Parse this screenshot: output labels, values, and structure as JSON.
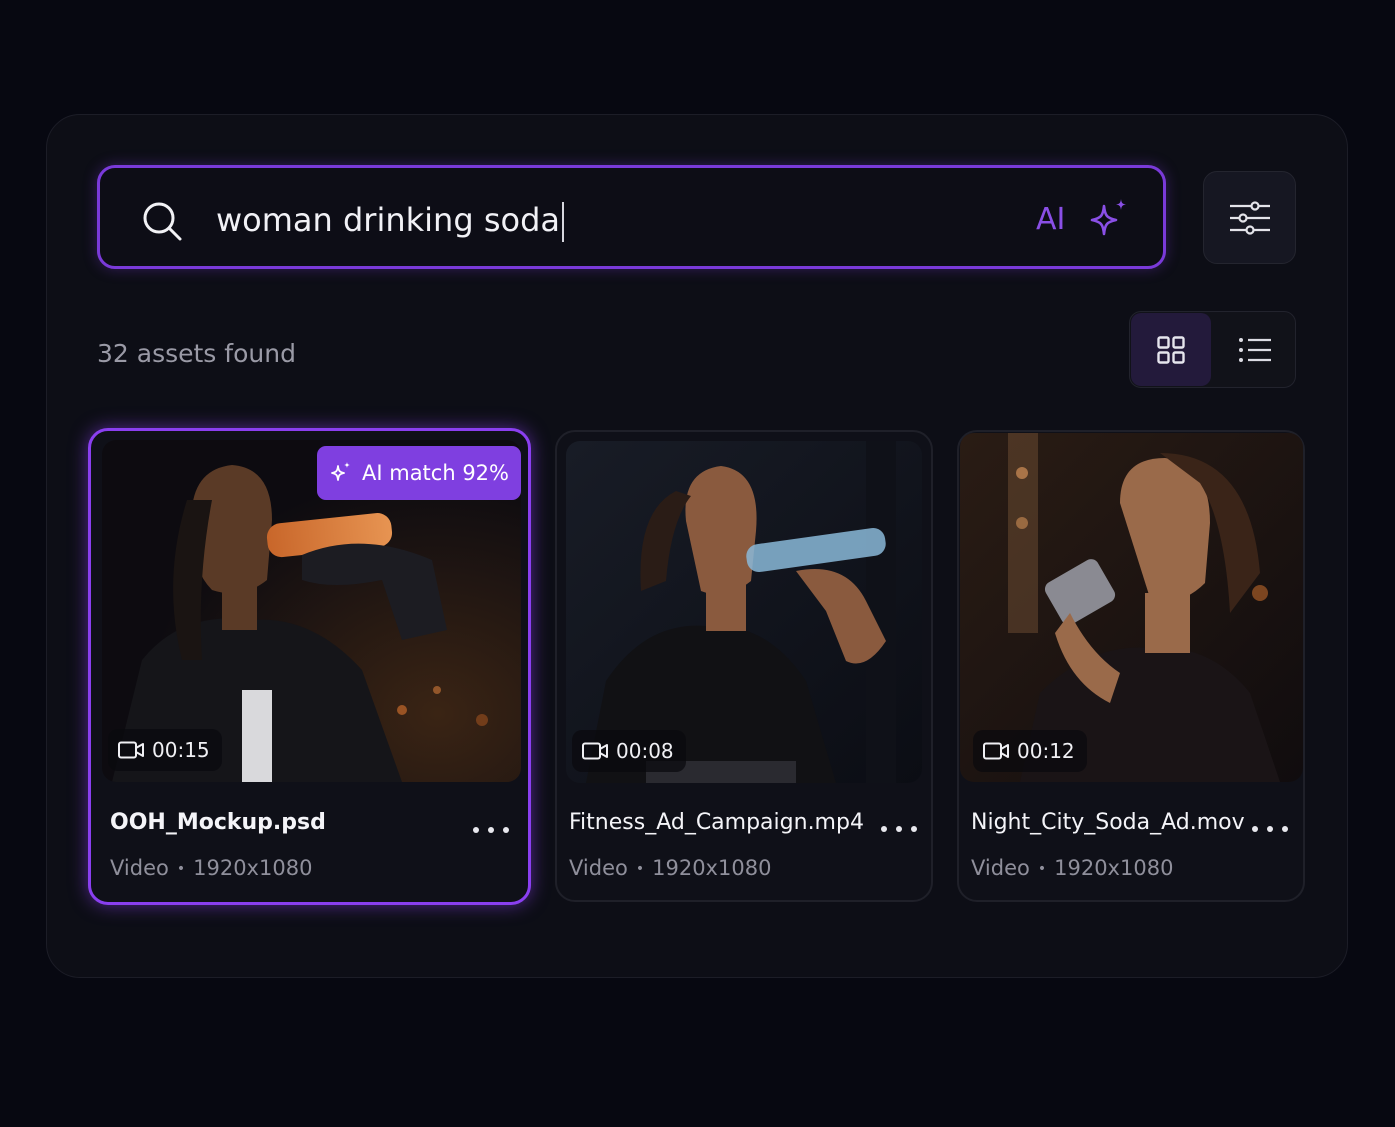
{
  "search": {
    "query": "woman drinking soda",
    "ai_label": "AI",
    "accent_color": "#7a3ad9"
  },
  "filter_button": {
    "icon": "sliders-icon"
  },
  "results": {
    "count_text": "32 assets found"
  },
  "view_toggle": {
    "active": "grid",
    "options": [
      "grid",
      "list"
    ]
  },
  "assets": [
    {
      "filename": "OOH_Mockup.psd",
      "type": "Video",
      "resolution": "1920x1080",
      "duration": "00:15",
      "ai_match": "AI match 92%",
      "selected": true
    },
    {
      "filename": "Fitness_Ad_Campaign.mp4",
      "type": "Video",
      "resolution": "1920x1080",
      "duration": "00:08",
      "selected": false
    },
    {
      "filename": "Night_City_Soda_Ad.mov",
      "type": "Video",
      "resolution": "1920x1080",
      "duration": "00:12",
      "selected": false
    }
  ]
}
